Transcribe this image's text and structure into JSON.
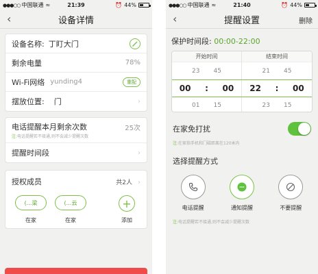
{
  "left": {
    "status": {
      "signal": "●●●○○",
      "carrier": "中国联通",
      "wifi": "≈",
      "time": "21:39",
      "battery": "44%",
      "battery_level": 0.44
    },
    "nav": {
      "back": "‹",
      "title": "设备详情"
    },
    "info": {
      "device_name_label": "设备名称:",
      "device_name_value": "丁盯大门",
      "battery_label": "剩余电量",
      "battery_value": "78%",
      "wifi_label": "Wi-Fi网络",
      "wifi_value": "yunding4",
      "wifi_button": "重配",
      "place_label": "摆放位置:",
      "place_value": "门"
    },
    "reminder": {
      "calls_label": "电话提醒本月剩余次数",
      "calls_value": "25次",
      "note_prefix": "注:",
      "note": "电话提醒若不接通,则不会减少提醒次数",
      "time_label": "提醒时间段"
    },
    "members": {
      "title": "授权成员",
      "count": "共2人",
      "items": [
        {
          "name": "(…梁",
          "status": "在家"
        },
        {
          "name": "(…云",
          "status": "在家"
        }
      ],
      "add_icon": "+",
      "add_label": "添加"
    }
  },
  "right": {
    "status": {
      "signal": "●●●○○",
      "carrier": "中国联通",
      "wifi": "≈",
      "time": "21:40",
      "battery": "44%",
      "battery_level": 0.44
    },
    "nav": {
      "back": "‹",
      "title": "提醒设置",
      "action": "删除"
    },
    "protect_label": "保护时间段:",
    "protect_range": "00:00-22:00",
    "picker": {
      "start_label": "开始时间",
      "end_label": "结束时间",
      "start_rows": [
        [
          "23",
          "45"
        ],
        [
          "00",
          "00"
        ],
        [
          "01",
          "15"
        ]
      ],
      "end_rows": [
        [
          "21",
          "45"
        ],
        [
          "22",
          "00"
        ],
        [
          "23",
          "15"
        ]
      ],
      "colon": ":"
    },
    "dnd_label": "在家免打扰",
    "dnd_on": true,
    "dnd_note_prefix": "注:",
    "dnd_note": "在家指手机和门磁距离在120米内",
    "mode_title": "选择提醒方式",
    "modes": [
      {
        "label": "电话提醒",
        "icon": "phone-icon"
      },
      {
        "label": "通知提醒",
        "icon": "chat-icon",
        "selected": true
      },
      {
        "label": "不要提醒",
        "icon": "block-icon"
      }
    ],
    "mode_note_prefix": "注:",
    "mode_note": "电话提醒若不接通,则不会减少提醒次数"
  },
  "colors": {
    "accent": "#7cc04a",
    "toggle": "#5ec23c",
    "danger": "#ef4b4b"
  }
}
